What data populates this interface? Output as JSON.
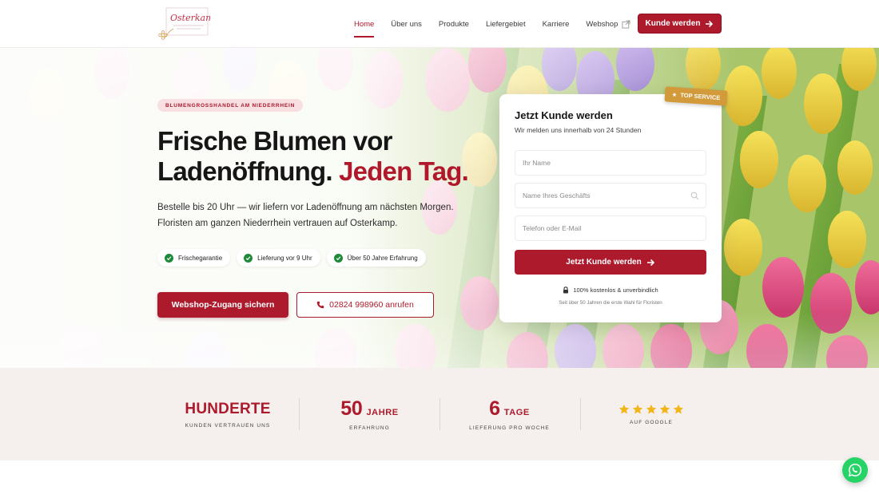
{
  "nav": {
    "items": [
      {
        "label": "Home"
      },
      {
        "label": "Über uns"
      },
      {
        "label": "Produkte"
      },
      {
        "label": "Liefergebiet"
      },
      {
        "label": "Karriere"
      },
      {
        "label": "Webshop"
      }
    ],
    "cta_label": "Kunde werden"
  },
  "brand": {
    "logo_text": "Osterkamp",
    "accent_color": "#ad1a2c"
  },
  "hero": {
    "badge": "BLUMENGROSSHANDEL AM NIEDERRHEIN",
    "title_line1": "Frische Blumen vor",
    "title_line2": "Ladenöffnung.",
    "title_accent": "Jeden Tag.",
    "lead": "Bestelle bis 20 Uhr — wir liefern vor Ladenöffnung am nächsten Morgen. Floristen am ganzen Niederrhein vertrauen auf Osterkamp.",
    "chips": [
      "Frischegarantie",
      "Lieferung vor 9 Uhr",
      "Über 50 Jahre Erfahrung"
    ],
    "primary_button": "Webshop-Zugang sichern",
    "secondary_button": "02824 998960 anrufen"
  },
  "form": {
    "ribbon": "TOP SERVICE",
    "title": "Jetzt Kunde werden",
    "subtitle": "Wir melden uns innerhalb von 24 Stunden",
    "name_placeholder": "Ihr Name",
    "shop_placeholder": "Name Ihres Geschäfts",
    "contact_placeholder": "Telefon oder E-Mail",
    "submit_label": "Jetzt Kunde werden",
    "note": "100% kostenlos & unverbindlich",
    "footnote": "Seit über 50 Jahren die erste Wahl für Floristen"
  },
  "stats": [
    {
      "value": "HUNDERTE",
      "unit": "",
      "label": "KUNDEN VERTRAUEN UNS"
    },
    {
      "value": "50",
      "unit": "JAHRE",
      "label": "ERFAHRUNG"
    },
    {
      "value": "6",
      "unit": "TAGE",
      "label": "LIEFERUNG PRO WOCHE"
    },
    {
      "stars": 5,
      "label": "AUF GOOGLE"
    }
  ],
  "whatsapp": {
    "icon": "whatsapp-icon"
  }
}
